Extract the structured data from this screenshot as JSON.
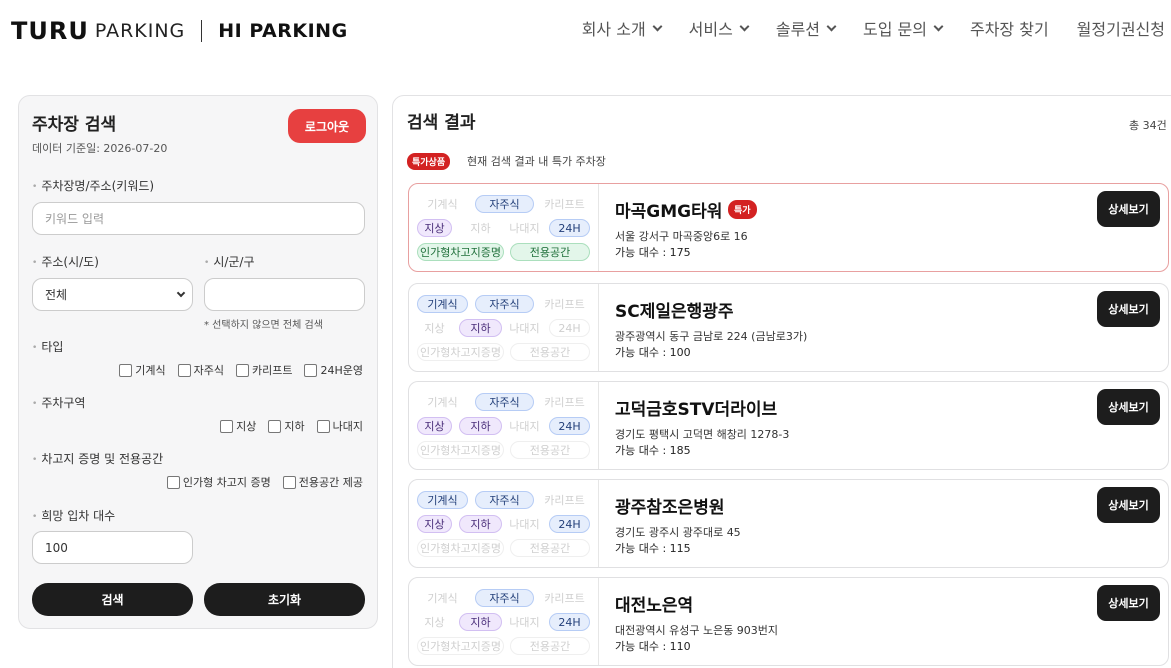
{
  "header": {
    "logo_turu": "TURU",
    "logo_parking": "PARKING",
    "logo_hi": "HI PARKING",
    "nav": [
      {
        "label": "회사 소개",
        "dropdown": true
      },
      {
        "label": "서비스",
        "dropdown": true
      },
      {
        "label": "솔루션",
        "dropdown": true
      },
      {
        "label": "도입 문의",
        "dropdown": true
      },
      {
        "label": "주차장 찾기",
        "dropdown": false
      },
      {
        "label": "월정기권신청",
        "dropdown": false
      }
    ]
  },
  "search": {
    "title": "주차장 검색",
    "date_text": "데이터 기준일: 2026-07-20",
    "logout_label": "로그아웃",
    "keyword_label": "주차장명/주소(키워드)",
    "keyword_placeholder": "키워드 입력",
    "sido_label": "주소(시/도)",
    "sido_value": "전체",
    "sigungu_label": "시/군/구",
    "sigungu_value": "",
    "sigungu_hint": "* 선택하지 않으면 전체 검색",
    "type_label": "타입",
    "type_options": [
      "기계식",
      "자주식",
      "카리프트",
      "24H운영"
    ],
    "zone_label": "주차구역",
    "zone_options": [
      "지상",
      "지하",
      "나대지"
    ],
    "garage_label": "차고지 증명 및 전용공간",
    "garage_options": [
      "인가형 차고지 증명",
      "전용공간 제공"
    ],
    "count_label": "희망 입차 대수",
    "count_value": "100",
    "search_btn": "검색",
    "reset_btn": "초기화"
  },
  "results": {
    "title": "검색 결과",
    "total": "총 34건",
    "special_tag": "특가상품",
    "special_text": "현재 검색 결과 내 특가 주차장",
    "badge_label": "특가",
    "detail_label": "상세보기",
    "capacity_prefix": "가능 대수 : ",
    "chip_labels": [
      "기계식",
      "자주식",
      "카리프트",
      "지상",
      "지하",
      "나대지",
      "24H",
      "인가형차고지증명",
      "전용공간"
    ],
    "items": [
      {
        "name": "마곡GMG타워",
        "special": true,
        "addr": "서울 강서구 마곡중앙6로 16",
        "cap": "가능 대수 : 175",
        "on": [
          false,
          true,
          false,
          true,
          false,
          false,
          true,
          true,
          true
        ]
      },
      {
        "name": "SC제일은행광주",
        "special": false,
        "addr": "광주광역시 동구 금남로 224 (금남로3가)",
        "cap": "가능 대수 : 100",
        "on": [
          true,
          true,
          false,
          false,
          true,
          false,
          false,
          false,
          false
        ]
      },
      {
        "name": "고덕금호STV더라이브",
        "special": false,
        "addr": "경기도 평택시 고덕면 해창리 1278-3",
        "cap": "가능 대수 : 185",
        "on": [
          false,
          true,
          false,
          true,
          true,
          false,
          true,
          false,
          false
        ]
      },
      {
        "name": "광주참조은병원",
        "special": false,
        "addr": "경기도 광주시 광주대로 45",
        "cap": "가능 대수 : 115",
        "on": [
          true,
          true,
          false,
          true,
          true,
          false,
          true,
          false,
          false
        ]
      },
      {
        "name": "대전노은역",
        "special": false,
        "addr": "대전광역시 유성구 노은동 903번지",
        "cap": "가능 대수 : 110",
        "on": [
          false,
          true,
          false,
          false,
          true,
          false,
          true,
          false,
          false
        ]
      }
    ]
  },
  "colors": {
    "accent_red": "#e74040",
    "dark": "#1d1d1d",
    "chip_blue": "#e6eefc",
    "chip_purple": "#f0e8fc",
    "chip_green": "#e3f6ea"
  }
}
